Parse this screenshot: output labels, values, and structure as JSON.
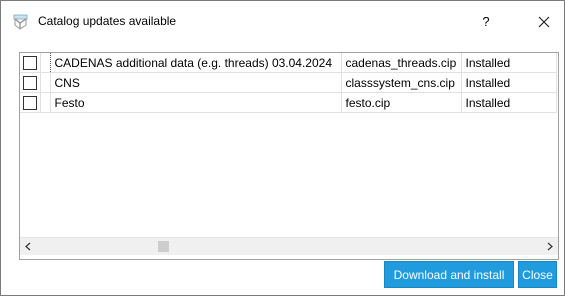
{
  "window": {
    "title": "Catalog updates available",
    "help_label": "?",
    "icons": {
      "app": "catalog-box-icon",
      "close": "close-icon"
    }
  },
  "table": {
    "rows": [
      {
        "checked": false,
        "name": "CADENAS additional data (e.g. threads) 03.04.2024",
        "file": "cadenas_threads.cip",
        "status": "Installed"
      },
      {
        "checked": false,
        "name": "CNS",
        "file": "classsystem_cns.cip",
        "status": "Installed"
      },
      {
        "checked": false,
        "name": "Festo",
        "file": "festo.cip",
        "status": "Installed"
      }
    ]
  },
  "scrollbar": {
    "left_arrow": "<",
    "right_arrow": ">"
  },
  "buttons": {
    "download_install": "Download and install",
    "close": "Close"
  },
  "colors": {
    "accent": "#1f9bde"
  }
}
